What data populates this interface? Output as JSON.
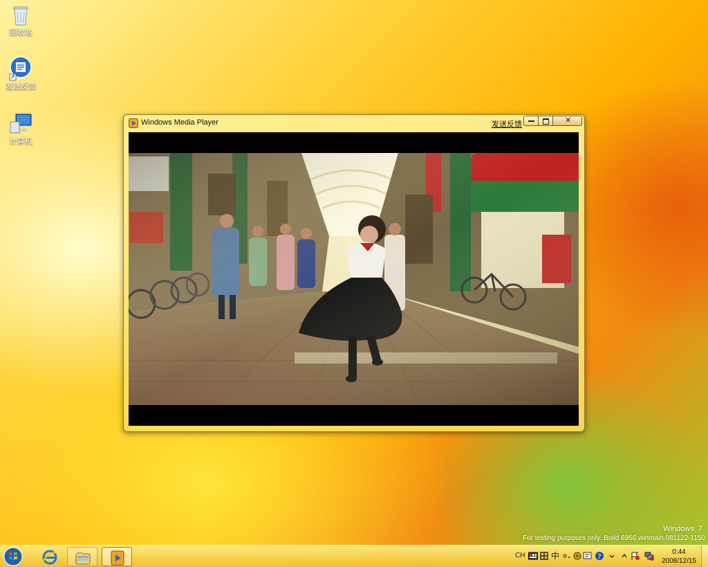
{
  "desktop": {
    "icons": [
      {
        "label": "回收站",
        "icon": "recycle-bin-icon"
      },
      {
        "label": "发送反馈",
        "icon": "feedback-icon"
      },
      {
        "label": "计算机",
        "icon": "computer-icon"
      }
    ]
  },
  "window": {
    "title": "Windows Media Player",
    "feedback_link": "发送反馈",
    "close_glyph": "✕",
    "video_scene": "street-dance-video-frame"
  },
  "watermark": {
    "os_name": "Windows",
    "os_version": "7",
    "build_text": "For testing purposes only. Build 6956.winmain.081122-1150"
  },
  "taskbar": {
    "language": "CH",
    "ime_label": "中",
    "clock_time": "0:44",
    "clock_date": "2008/12/15",
    "pinned": [
      "internet-explorer-icon",
      "windows-explorer-icon",
      "media-player-icon"
    ]
  },
  "colors": {
    "taskbar": "#f0c030",
    "window_frame": "#ffe680",
    "video_bg": "#000000"
  }
}
